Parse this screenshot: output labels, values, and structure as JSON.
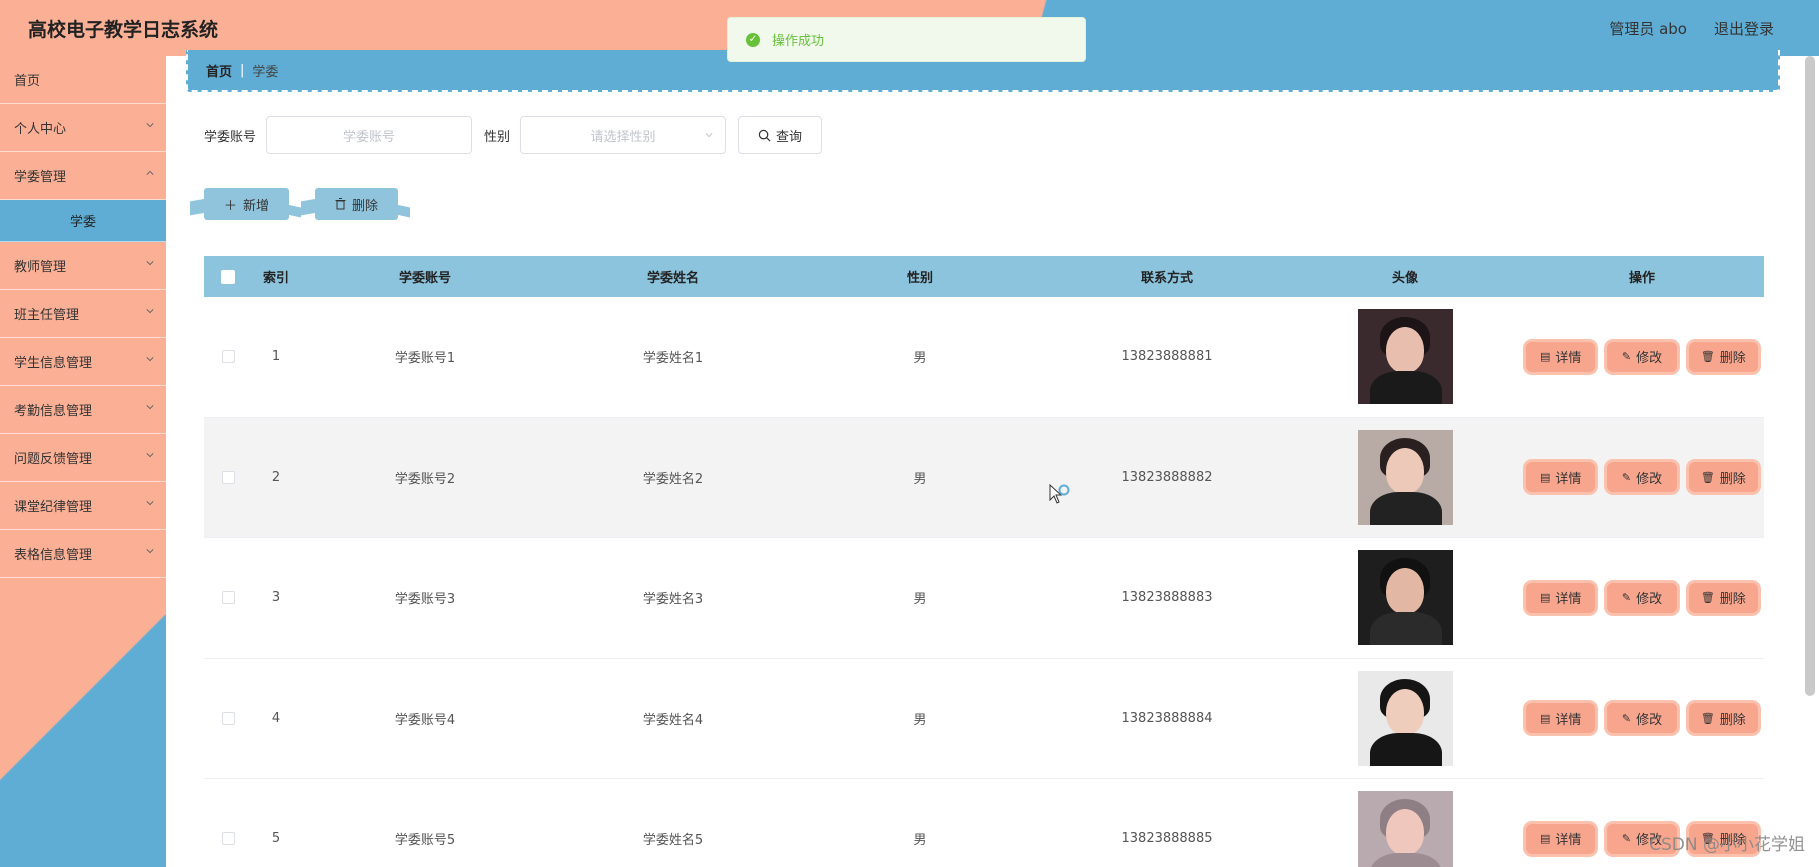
{
  "app": {
    "title": "高校电子教学日志系统",
    "user": "管理员 abo",
    "logout": "退出登录"
  },
  "toast": {
    "message": "操作成功"
  },
  "sidebar": {
    "items": [
      {
        "label": "首页",
        "has_arrow": false
      },
      {
        "label": "个人中心",
        "has_arrow": true
      },
      {
        "label": "学委管理",
        "has_arrow": true
      },
      {
        "label": "学委",
        "sub": true
      },
      {
        "label": "教师管理",
        "has_arrow": true
      },
      {
        "label": "班主任管理",
        "has_arrow": true
      },
      {
        "label": "学生信息管理",
        "has_arrow": true
      },
      {
        "label": "考勤信息管理",
        "has_arrow": true
      },
      {
        "label": "问题反馈管理",
        "has_arrow": true
      },
      {
        "label": "课堂纪律管理",
        "has_arrow": true
      },
      {
        "label": "表格信息管理",
        "has_arrow": true
      }
    ]
  },
  "breadcrumb": {
    "home": "首页",
    "separator": "|",
    "current": "学委"
  },
  "search": {
    "account_label": "学委账号",
    "account_placeholder": "学委账号",
    "gender_label": "性别",
    "gender_placeholder": "请选择性别",
    "query_button": "查询"
  },
  "toolbar": {
    "add_button": "新增",
    "delete_button": "删除"
  },
  "table": {
    "headers": {
      "index": "索引",
      "account": "学委账号",
      "name": "学委姓名",
      "gender": "性别",
      "contact": "联系方式",
      "avatar": "头像",
      "operations": "操作"
    },
    "rows": [
      {
        "index": "1",
        "account": "学委账号1",
        "name": "学委姓名1",
        "gender": "男",
        "contact": "13823888881"
      },
      {
        "index": "2",
        "account": "学委账号2",
        "name": "学委姓名2",
        "gender": "男",
        "contact": "13823888882"
      },
      {
        "index": "3",
        "account": "学委账号3",
        "name": "学委姓名3",
        "gender": "男",
        "contact": "13823888883"
      },
      {
        "index": "4",
        "account": "学委账号4",
        "name": "学委姓名4",
        "gender": "男",
        "contact": "13823888884"
      },
      {
        "index": "5",
        "account": "学委账号5",
        "name": "学委姓名5",
        "gender": "男",
        "contact": "13823888885"
      }
    ],
    "row_actions": {
      "detail": "详情",
      "edit": "修改",
      "delete": "删除"
    }
  },
  "watermark": "CSDN @小小花学姐",
  "colors": {
    "peach": "#fbb096",
    "blue": "#5fadd4",
    "header_row": "#8cc4de",
    "toast_green": "#67c23a",
    "op_button": "#f8a58d"
  }
}
